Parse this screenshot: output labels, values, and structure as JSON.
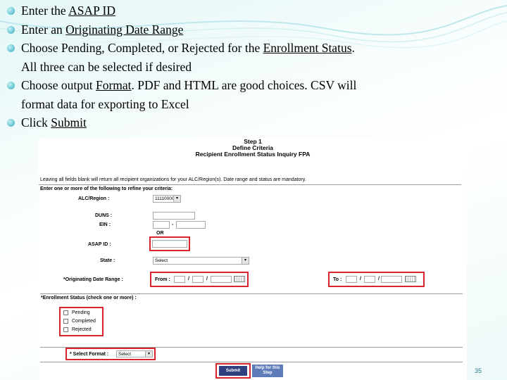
{
  "bullets": [
    {
      "pre": "Enter the ",
      "link": "ASAP ID",
      "post": "",
      "line2": ""
    },
    {
      "pre": "Enter an ",
      "link": "Originating Date Range",
      "post": "",
      "line2": ""
    },
    {
      "pre": "Choose Pending, Completed, or Rejected for the ",
      "link": "Enrollment Status",
      "post": ".",
      "line2": "All three can be selected if desired"
    },
    {
      "pre": "Choose output ",
      "link": "Format",
      "post": ".  PDF and HTML are good choices.  CSV will",
      "line2": "format data for exporting to Excel"
    },
    {
      "pre": "Click ",
      "link": "Submit",
      "post": "",
      "line2": ""
    }
  ],
  "screen": {
    "step": "Step 1",
    "define": "Define Criteria",
    "report_title": "Recipient Enrollment Status Inquiry FPA",
    "note": "Leaving all fields blank will return all recipient organizations for your ALC/Region(s). Date range and status are mandatory.",
    "instruction": "Enter one or more of the following to refine your criteria:",
    "alc_label": "ALC/Region :",
    "alc_value": "11110000",
    "duns_label": "DUNS :",
    "ein_label": "EIN :",
    "ein_sep": "-",
    "or_label": "OR",
    "asap_label": "ASAP ID :",
    "state_label": "State :",
    "state_value": "Select",
    "date_label": "*Originating Date Range :",
    "from_label": "From :",
    "to_label": "To :",
    "slash": "/",
    "status_legend": "*Enrollment Status (check one or more) :",
    "status_options": [
      "Pending",
      "Completed",
      "Rejected"
    ],
    "format_label": "* Select Format :",
    "format_value": "Select",
    "submit_label": "Submit",
    "help_label": "Help for this Step"
  },
  "page_number": "35",
  "colors": {
    "highlight": "#d9232d",
    "submit": "#2f3f7f",
    "help": "#5d7cb8",
    "page_number": "#2a7f8c"
  }
}
